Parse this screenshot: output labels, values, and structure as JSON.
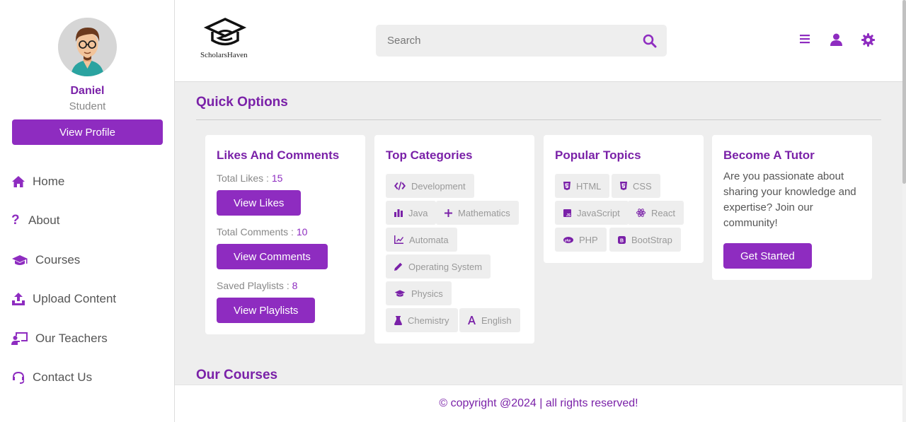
{
  "profile": {
    "name": "Daniel",
    "role": "Student",
    "view_profile_label": "View Profile"
  },
  "nav": {
    "items": [
      {
        "label": "Home",
        "icon": "home-icon"
      },
      {
        "label": "About",
        "icon": "question-icon"
      },
      {
        "label": "Courses",
        "icon": "graduation-cap-icon"
      },
      {
        "label": "Upload Content",
        "icon": "upload-icon"
      },
      {
        "label": "Our Teachers",
        "icon": "teacher-icon"
      },
      {
        "label": "Contact Us",
        "icon": "headset-icon"
      }
    ]
  },
  "header": {
    "logo_text": "ScholarsHaven",
    "search_placeholder": "Search",
    "icons": [
      "menu-icon",
      "user-icon",
      "settings-icon"
    ]
  },
  "main": {
    "quick_options_title": "Quick Options",
    "our_courses_title": "Our Courses",
    "likes_card": {
      "title": "Likes And Comments",
      "total_likes_label": "Total Likes : ",
      "total_likes": "15",
      "view_likes_label": "View Likes",
      "total_comments_label": "Total Comments : ",
      "total_comments": "10",
      "view_comments_label": "View Comments",
      "saved_playlists_label": "Saved Playlists : ",
      "saved_playlists": "8",
      "view_playlists_label": "View Playlists"
    },
    "categories_card": {
      "title": "Top Categories",
      "tags": [
        {
          "label": "Development",
          "icon": "code-icon"
        },
        {
          "label": "Java",
          "icon": "bar-chart-icon"
        },
        {
          "label": "Mathematics",
          "icon": "plus-icon"
        },
        {
          "label": "Automata",
          "icon": "line-chart-icon"
        },
        {
          "label": "Operating System",
          "icon": "pencil-icon"
        },
        {
          "label": "Physics",
          "icon": "graduation-cap-icon"
        },
        {
          "label": "Chemistry",
          "icon": "flask-icon"
        },
        {
          "label": "English",
          "icon": "letter-a-icon"
        }
      ]
    },
    "topics_card": {
      "title": "Popular Topics",
      "tags": [
        {
          "label": "HTML",
          "icon": "html5-icon"
        },
        {
          "label": "CSS",
          "icon": "css3-icon"
        },
        {
          "label": "JavaScript",
          "icon": "js-icon"
        },
        {
          "label": "React",
          "icon": "react-icon"
        },
        {
          "label": "PHP",
          "icon": "php-icon"
        },
        {
          "label": "BootStrap",
          "icon": "bootstrap-icon"
        }
      ]
    },
    "tutor_card": {
      "title": "Become A Tutor",
      "text": "Are you passionate about sharing your knowledge and expertise? Join our community!",
      "button_label": "Get Started"
    }
  },
  "footer": {
    "text": "© copyright @2024 | all rights reserved!"
  },
  "colors": {
    "accent": "#8e2cc0",
    "accent_text": "#7a21a8",
    "background": "#eeeeee"
  }
}
